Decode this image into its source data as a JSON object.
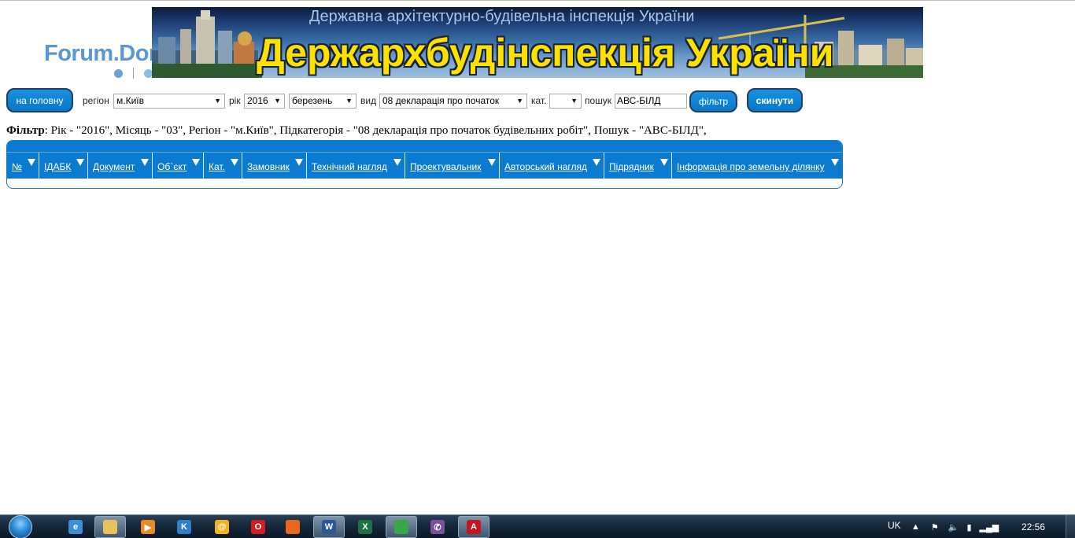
{
  "site": {
    "logo_text": "Forum.Domik.ua",
    "banner_subtitle": "Державна архітектурно-будівельна інспекція України",
    "banner_title": "Держархбудінспекція України"
  },
  "filter_bar": {
    "home_button": "на головну",
    "region_label": "регіон",
    "region_value": "м.Київ",
    "year_label": "рік",
    "year_value": "2016",
    "month_value": "березень",
    "type_label": "вид",
    "type_value": "08 декларація про початок",
    "category_label": "кат.",
    "category_value": "",
    "search_label": "пошук",
    "search_value": "АВС-БІЛД",
    "filter_button": "фільтр",
    "reset_button": "скинути"
  },
  "filter_summary": {
    "label": "Фільтр",
    "text": ": Рік - \"2016\", Місяць - \"03\", Регіон - \"м.Київ\", Підкатегорія - \"08 декларація про початок будівельних робіт\", Пошук - \"АВС-БІЛД\","
  },
  "table": {
    "columns": [
      "№",
      "ІДАБК",
      "Документ",
      "Об`єкт",
      "Кат.",
      "Замовник",
      "Технічний нагляд",
      "Проектувальник",
      "Авторський нагляд",
      "Підрядник",
      "Інформація про земельну ділянку"
    ],
    "rows": []
  },
  "taskbar": {
    "apps": [
      {
        "name": "internet-explorer",
        "label": "e",
        "color": "#3a8fd9"
      },
      {
        "name": "file-explorer",
        "label": "",
        "color": "#e8c25a"
      },
      {
        "name": "media-player",
        "label": "▶",
        "color": "#e98a22"
      },
      {
        "name": "k-lite",
        "label": "K",
        "color": "#2d7fc9"
      },
      {
        "name": "mail-agent",
        "label": "@",
        "color": "#f0b51e"
      },
      {
        "name": "opera",
        "label": "O",
        "color": "#d21e1e"
      },
      {
        "name": "firefox",
        "label": "",
        "color": "#e8661d"
      },
      {
        "name": "word",
        "label": "W",
        "color": "#2b5797"
      },
      {
        "name": "excel",
        "label": "X",
        "color": "#1e7145"
      },
      {
        "name": "chrome",
        "label": "",
        "color": "#3aa64a"
      },
      {
        "name": "viber",
        "label": "✆",
        "color": "#7b519d"
      },
      {
        "name": "acrobat",
        "label": "A",
        "color": "#c8151b"
      }
    ],
    "language": "UK",
    "clock": "22:56"
  }
}
